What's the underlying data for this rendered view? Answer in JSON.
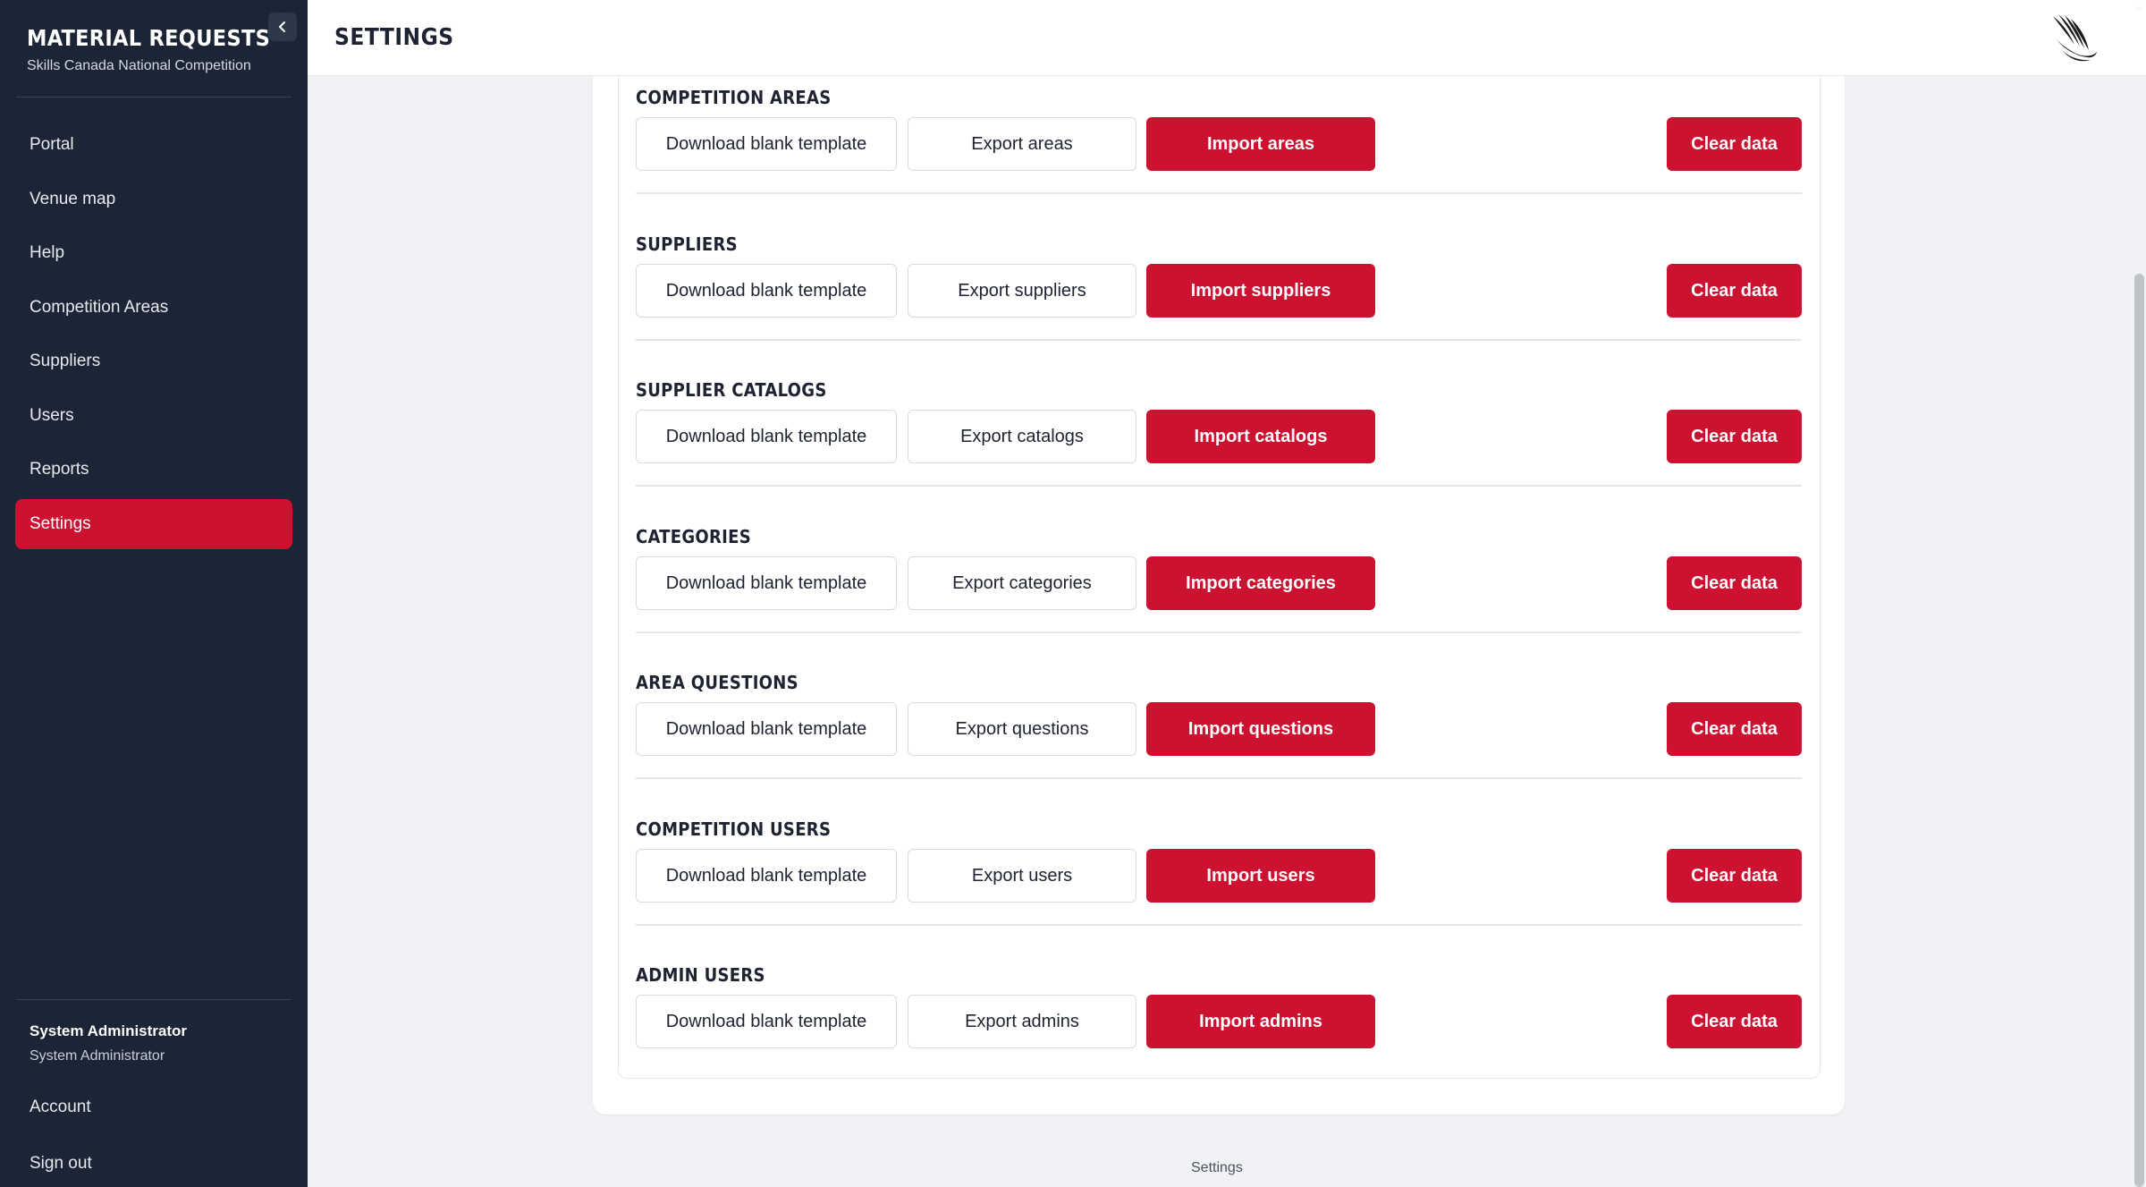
{
  "sidebar": {
    "app_title": "MATERIAL REQUESTS",
    "app_subtitle": "Skills Canada National Competition",
    "items": [
      {
        "label": "Portal"
      },
      {
        "label": "Venue map"
      },
      {
        "label": "Help"
      },
      {
        "label": "Competition Areas"
      },
      {
        "label": "Suppliers"
      },
      {
        "label": "Users"
      },
      {
        "label": "Reports"
      },
      {
        "label": "Settings",
        "active": true
      }
    ],
    "user": {
      "name": "System Administrator",
      "role": "System Administrator"
    },
    "account_label": "Account",
    "signout_label": "Sign out"
  },
  "header": {
    "title": "SETTINGS"
  },
  "sections": [
    {
      "title": "COMPETITION AREAS",
      "template_label": "Download blank template",
      "export_label": "Export areas",
      "import_label": "Import areas",
      "clear_label": "Clear data"
    },
    {
      "title": "SUPPLIERS",
      "template_label": "Download blank template",
      "export_label": "Export suppliers",
      "import_label": "Import suppliers",
      "clear_label": "Clear data"
    },
    {
      "title": "SUPPLIER CATALOGS",
      "template_label": "Download blank template",
      "export_label": "Export catalogs",
      "import_label": "Import catalogs",
      "clear_label": "Clear data"
    },
    {
      "title": "CATEGORIES",
      "template_label": "Download blank template",
      "export_label": "Export categories",
      "import_label": "Import categories",
      "clear_label": "Clear data"
    },
    {
      "title": "AREA QUESTIONS",
      "template_label": "Download blank template",
      "export_label": "Export questions",
      "import_label": "Import questions",
      "clear_label": "Clear data"
    },
    {
      "title": "COMPETITION USERS",
      "template_label": "Download blank template",
      "export_label": "Export users",
      "import_label": "Import users",
      "clear_label": "Clear data"
    },
    {
      "title": "ADMIN USERS",
      "template_label": "Download blank template",
      "export_label": "Export admins",
      "import_label": "Import admins",
      "clear_label": "Clear data"
    }
  ],
  "footer": {
    "text": "Settings"
  },
  "colors": {
    "accent": "#cc1230",
    "sidebar_bg": "#1b2535",
    "page_bg": "#f1f2f5"
  }
}
